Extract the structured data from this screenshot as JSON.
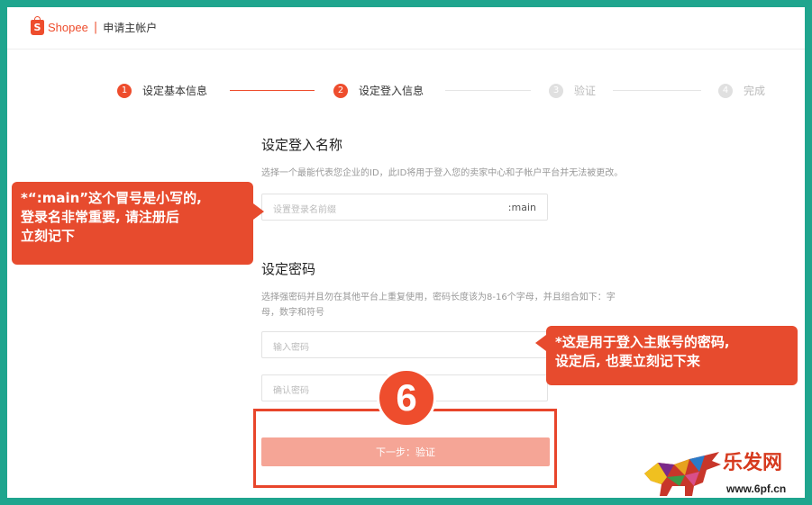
{
  "header": {
    "brand": "Shopee",
    "separator": "|",
    "subtitle": "申请主帐户"
  },
  "steps": [
    {
      "number": "1",
      "label": "设定基本信息",
      "state": "done"
    },
    {
      "number": "2",
      "label": "设定登入信息",
      "state": "current"
    },
    {
      "number": "3",
      "label": "验证",
      "state": "todo"
    },
    {
      "number": "4",
      "label": "完成",
      "state": "todo"
    }
  ],
  "login_section": {
    "title": "设定登入名称",
    "hint": "选择一个最能代表您企业的ID，此ID将用于登入您的卖家中心和子帐户平台并无法被更改。",
    "input_placeholder": "设置登录名前缀",
    "input_suffix": ":main"
  },
  "password_section": {
    "title": "设定密码",
    "hint_line1": "选择强密码并且勿在其他平台上重复使用，密码长度该为8-16个字母，并且组合如下：字",
    "hint_line2": "母，数字和符号",
    "password_placeholder": "输入密码",
    "confirm_placeholder": "确认密码"
  },
  "next_button": "下一步：验证",
  "annotations": {
    "step_badge": "6",
    "left_callout_line1": "*“:main”这个冒号是小写的,",
    "left_callout_line2": "登录名非常重要, 请注册后",
    "left_callout_line3": "立刻记下",
    "right_callout_line1": "*这是用于登入主账号的密码,",
    "right_callout_line2": "设定后, 也要立刻记下来"
  },
  "watermark": {
    "title": "乐发网",
    "url": "www.6pf.cn"
  },
  "colors": {
    "brand": "#ee4d2d",
    "frame": "#1fa58e",
    "button_disabled": "#f5a596",
    "callout": "#e74b2e"
  }
}
